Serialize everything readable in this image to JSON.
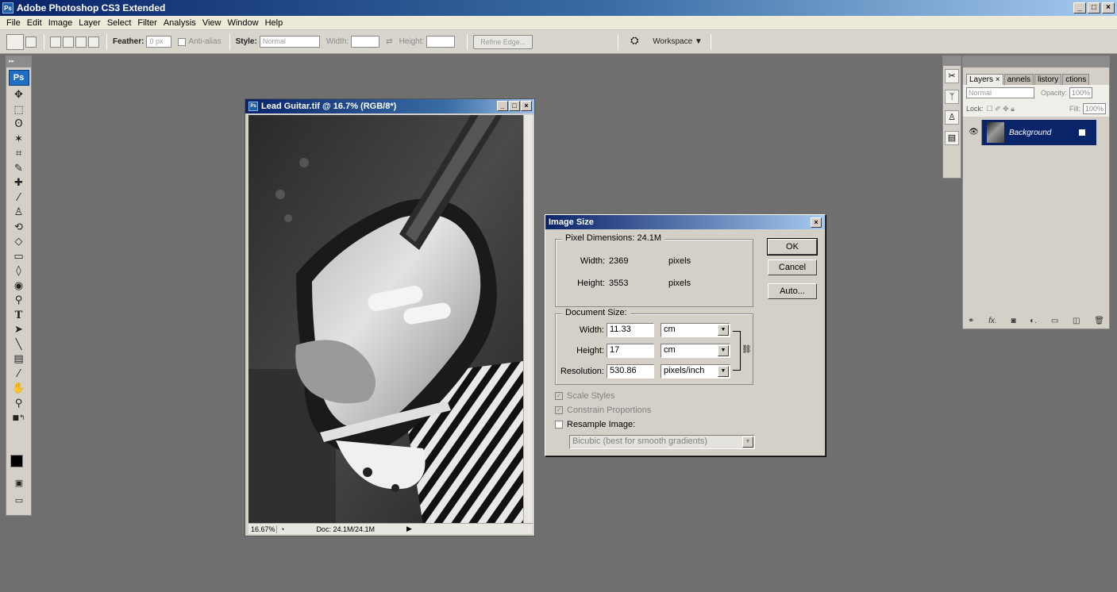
{
  "app": {
    "title": "Adobe Photoshop CS3 Extended",
    "badge": "Ps"
  },
  "menu": [
    "File",
    "Edit",
    "Image",
    "Layer",
    "Select",
    "Filter",
    "Analysis",
    "View",
    "Window",
    "Help"
  ],
  "options": {
    "feather_label": "Feather:",
    "feather_value": "0 px",
    "antialias_label": "Anti-alias",
    "style_label": "Style:",
    "style_value": "Normal",
    "width_label": "Width:",
    "height_label": "Height:",
    "refine_edge": "Refine Edge...",
    "workspace": "Workspace ▼"
  },
  "tools": {
    "logo": "Ps",
    "icons": [
      "move-tool",
      "marquee-tool",
      "lasso-tool",
      "magic-wand-tool",
      "crop-tool",
      "slice-tool",
      "healing-brush-tool",
      "brush-tool",
      "clone-stamp-tool",
      "history-brush-tool",
      "eraser-tool",
      "gradient-tool",
      "blur-tool",
      "dodge-tool",
      "pen-tool",
      "type-tool",
      "path-selection-tool",
      "line-tool",
      "notes-tool",
      "eyedropper-tool",
      "hand-tool",
      "zoom-tool"
    ]
  },
  "document": {
    "title": "Lead Guitar.tif @ 16.7% (RGB/8*)",
    "zoom": "16.67%",
    "doc_size": "Doc: 24.1M/24.1M"
  },
  "dialog": {
    "title": "Image Size",
    "close": "×",
    "pixel_dimensions_label": "Pixel Dimensions: 24.1M",
    "px_width_label": "Width:",
    "px_width_value": "2369",
    "px_width_unit": "pixels",
    "px_height_label": "Height:",
    "px_height_value": "3553",
    "px_height_unit": "pixels",
    "document_size_label": "Document Size:",
    "doc_width_label": "Width:",
    "doc_width_value": "11.33",
    "doc_width_unit": "cm",
    "doc_height_label": "Height:",
    "doc_height_value": "17",
    "doc_height_unit": "cm",
    "resolution_label": "Resolution:",
    "resolution_value": "530.86",
    "resolution_unit": "pixels/inch",
    "scale_styles": "Scale Styles",
    "constrain_proportions": "Constrain Proportions",
    "resample_image": "Resample Image:",
    "resample_method": "Bicubic (best for smooth gradients)",
    "ok": "OK",
    "cancel": "Cancel",
    "auto": "Auto..."
  },
  "layers_panel": {
    "tabs": [
      "Layers ×",
      "annels",
      "listory",
      "ctions"
    ],
    "blend_mode": "Normal",
    "opacity_label": "Opacity:",
    "opacity_value": "100%",
    "lock_label": "Lock:",
    "fill_label": "Fill:",
    "fill_value": "100%",
    "layer_name": "Background"
  }
}
